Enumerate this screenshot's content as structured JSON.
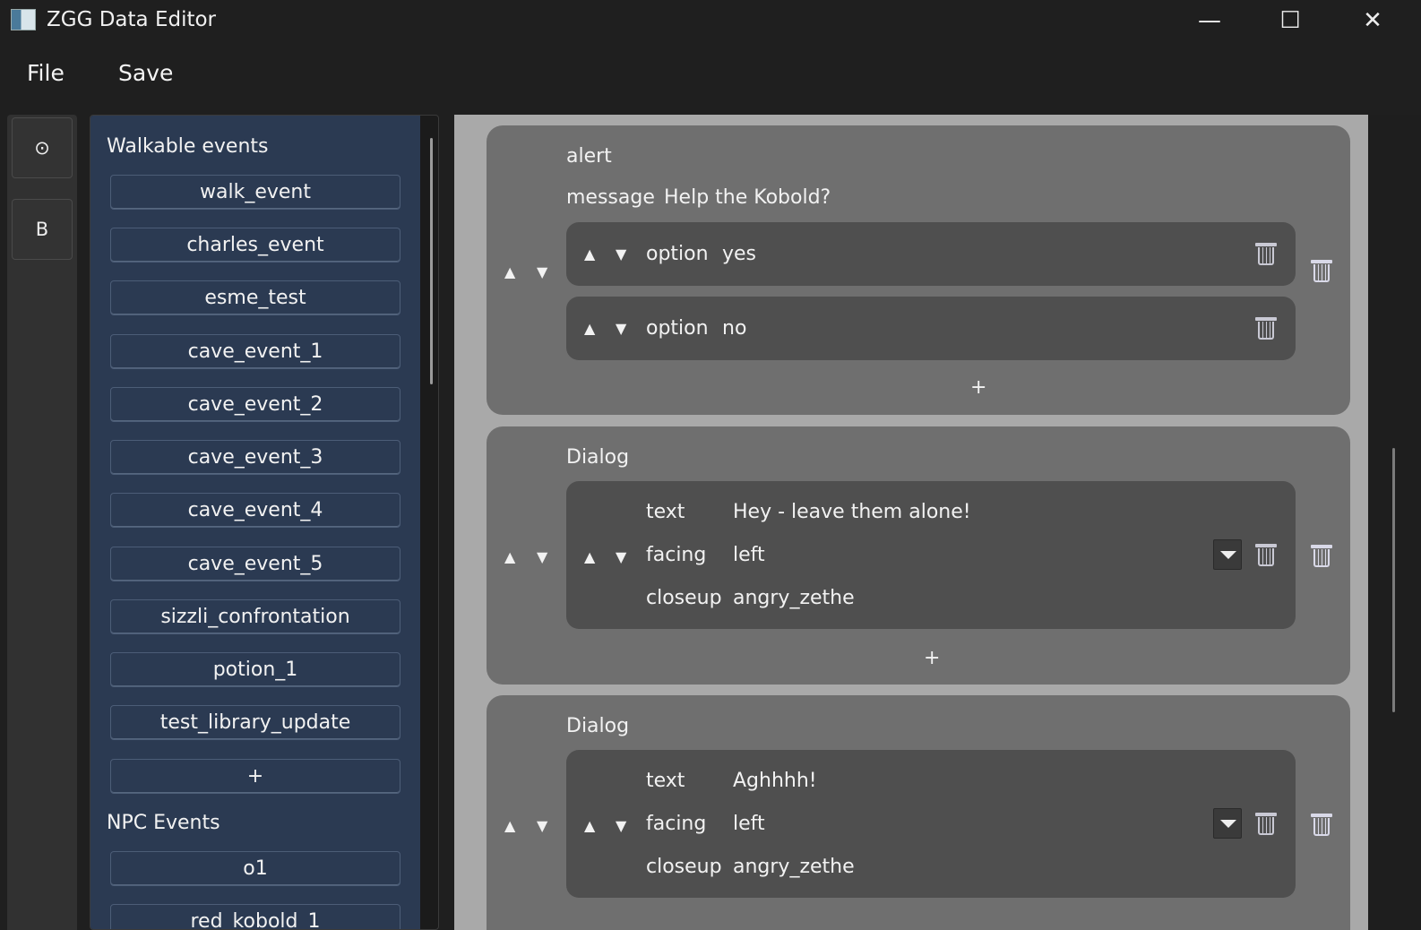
{
  "window": {
    "title": "ZGG Data Editor",
    "icon": "app-icon",
    "controls": {
      "minimize": "—",
      "maximize": "☐",
      "close": "✕"
    }
  },
  "menubar": {
    "file": "File",
    "save": "Save"
  },
  "rail": {
    "btn1": "⊙",
    "btn2": "B"
  },
  "sidebar": {
    "walkable_title": "Walkable events",
    "walkable_events": [
      "walk_event",
      "charles_event",
      "esme_test",
      "cave_event_1",
      "cave_event_2",
      "cave_event_3",
      "cave_event_4",
      "cave_event_5",
      "sizzli_confrontation",
      "potion_1",
      "test_library_update"
    ],
    "add_label": "+",
    "npc_title": "NPC Events",
    "npc_events": [
      "o1",
      "red_kobold_1"
    ]
  },
  "editor": {
    "cards": [
      {
        "type": "alert",
        "message_key": "message",
        "message_value": "Help the Kobold?",
        "options": [
          {
            "key": "option",
            "value": "yes"
          },
          {
            "key": "option",
            "value": "no"
          }
        ],
        "add_label": "+"
      },
      {
        "type": "Dialog",
        "text_key": "text",
        "text_value": "Hey - leave them alone!",
        "facing_key": "facing",
        "facing_value": "left",
        "closeup_key": "closeup",
        "closeup_value": "angry_zethe",
        "add_label": "+"
      },
      {
        "type": "Dialog",
        "text_key": "text",
        "text_value": "Aghhhh!",
        "facing_key": "facing",
        "facing_value": "left",
        "closeup_key": "closeup",
        "closeup_value": "angry_zethe"
      }
    ],
    "arrow_up": "▲",
    "arrow_down": "▼"
  },
  "colors": {
    "sidebar_bg": "#2b3a52",
    "card_bg": "#6f6f6f",
    "subcard_bg": "#4f4f4f",
    "editor_bg": "#a9a9a9"
  }
}
